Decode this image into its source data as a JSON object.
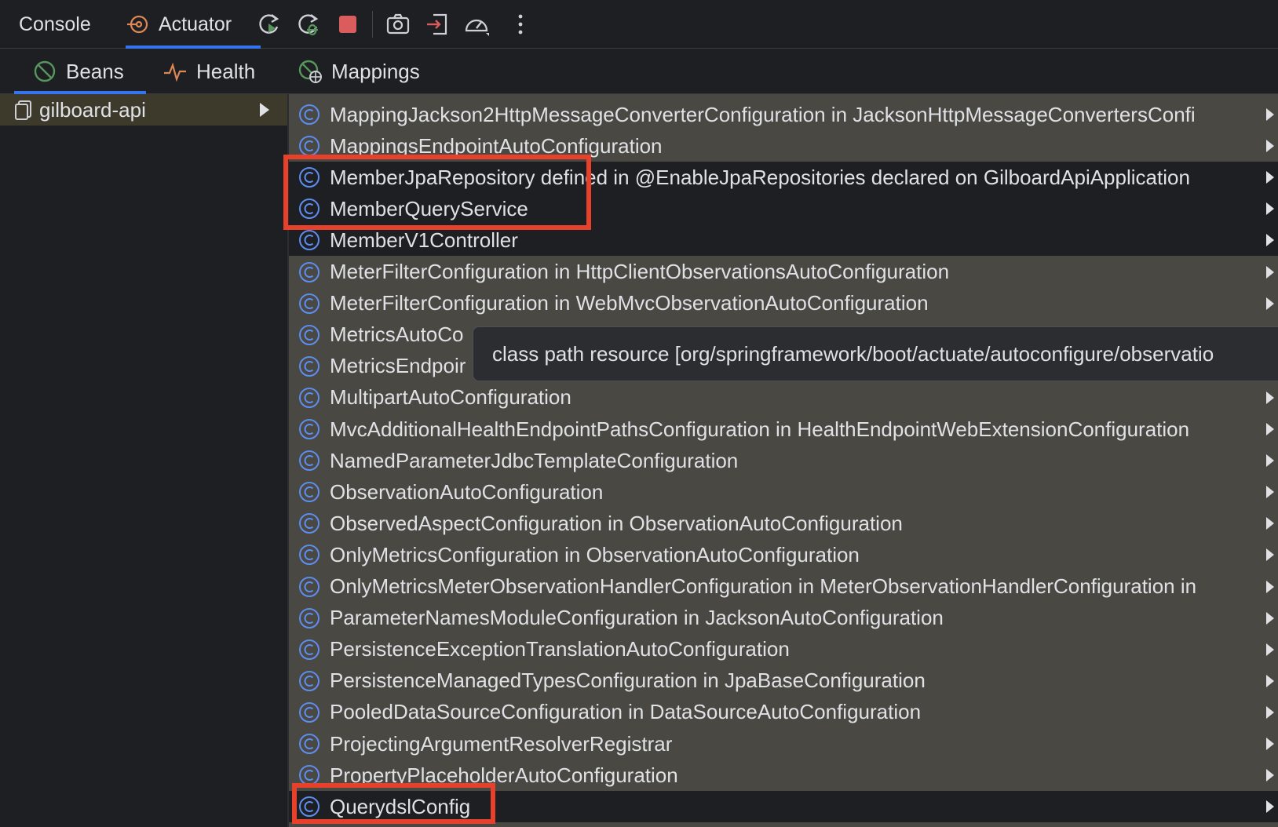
{
  "toolbar": {
    "tabs": [
      {
        "label": "Console"
      },
      {
        "label": "Actuator"
      }
    ]
  },
  "subtabs": [
    {
      "label": "Beans"
    },
    {
      "label": "Health"
    },
    {
      "label": "Mappings"
    }
  ],
  "left_tree": {
    "root_label": "gilboard-api"
  },
  "beans": [
    "MappingJackson2HttpMessageConverterConfiguration in JacksonHttpMessageConvertersConfi",
    "MappingsEndpointAutoConfiguration",
    "MemberJpaRepository defined in @EnableJpaRepositories declared on GilboardApiApplication",
    "MemberQueryService",
    "MemberV1Controller",
    "MeterFilterConfiguration in HttpClientObservationsAutoConfiguration",
    "MeterFilterConfiguration in WebMvcObservationAutoConfiguration",
    "MetricsAutoCo",
    "MetricsEndpoir",
    "MultipartAutoConfiguration",
    "MvcAdditionalHealthEndpointPathsConfiguration in HealthEndpointWebExtensionConfiguration",
    "NamedParameterJdbcTemplateConfiguration",
    "ObservationAutoConfiguration",
    "ObservedAspectConfiguration in ObservationAutoConfiguration",
    "OnlyMetricsConfiguration in ObservationAutoConfiguration",
    "OnlyMetricsMeterObservationHandlerConfiguration in MeterObservationHandlerConfiguration in",
    "ParameterNamesModuleConfiguration in JacksonAutoConfiguration",
    "PersistenceExceptionTranslationAutoConfiguration",
    "PersistenceManagedTypesConfiguration in JpaBaseConfiguration",
    "PooledDataSourceConfiguration in DataSourceAutoConfiguration",
    "ProjectingArgumentResolverRegistrar",
    "PropertyPlaceholderAutoConfiguration",
    "QuerydslConfig"
  ],
  "tooltip": {
    "text": "class path resource [org/springframework/boot/actuate/autoconfigure/observatio"
  },
  "colors": {
    "accent": "#3574f0",
    "highlight": "#e8412b",
    "class_icon": "#5e8df0",
    "bean_row_bg": "#4a4842",
    "selected_row_bg": "#1e1f22"
  }
}
